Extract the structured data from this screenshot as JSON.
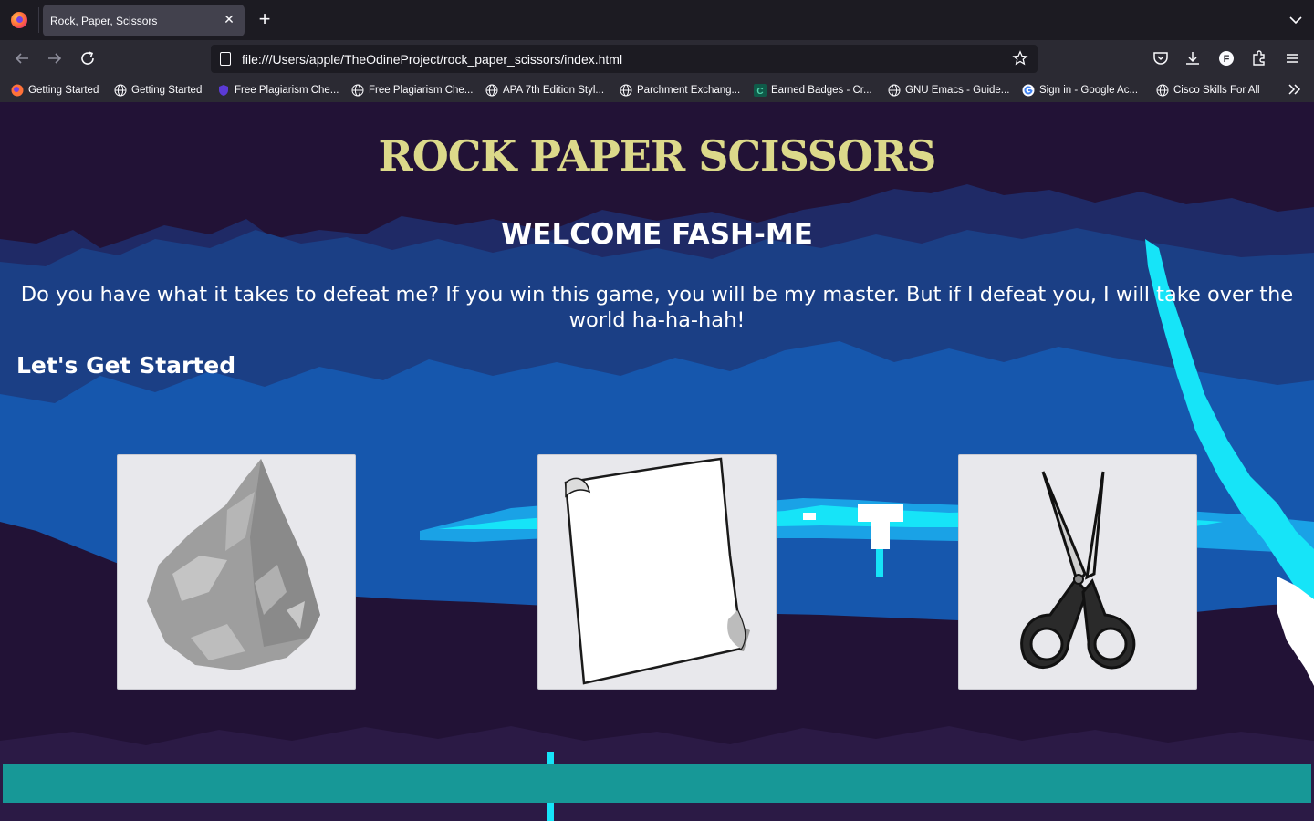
{
  "browser": {
    "tab_title": "Rock, Paper, Scissors",
    "url": "file:///Users/apple/TheOdineProject/rock_paper_scissors/index.html",
    "bookmarks": [
      {
        "label": "Getting Started",
        "icon": "firefox-icon"
      },
      {
        "label": "Getting Started",
        "icon": "globe-icon"
      },
      {
        "label": "Free Plagiarism Che...",
        "icon": "shield-icon"
      },
      {
        "label": "Free Plagiarism Che...",
        "icon": "globe-icon"
      },
      {
        "label": "APA 7th Edition Styl...",
        "icon": "globe-icon"
      },
      {
        "label": "Parchment Exchang...",
        "icon": "globe-icon"
      },
      {
        "label": "Earned Badges - Cr...",
        "icon": "credly-icon"
      },
      {
        "label": "GNU Emacs - Guide...",
        "icon": "globe-icon"
      },
      {
        "label": "Sign in - Google Ac...",
        "icon": "google-icon"
      },
      {
        "label": "Cisco Skills For All",
        "icon": "globe-icon"
      }
    ]
  },
  "page": {
    "title": "ROCK PAPER SCISSORS",
    "welcome": "WELCOME FASH-ME",
    "intro": "Do you have what it takes to defeat me? If you win this game, you will be my master. But if I defeat you, I will take over the world ha-ha-hah!",
    "start_heading": "Let's Get Started",
    "choices": [
      {
        "name": "rock",
        "icon": "rock-icon"
      },
      {
        "name": "paper",
        "icon": "paper-icon"
      },
      {
        "name": "scissors",
        "icon": "scissors-icon"
      }
    ]
  },
  "colors": {
    "title": "#dcd98a",
    "background_dark": "#221236",
    "background_blue": "#1b3f85",
    "glow": "#16e4f8",
    "footer_bar": "#179897",
    "card": "#e8e8ec"
  }
}
